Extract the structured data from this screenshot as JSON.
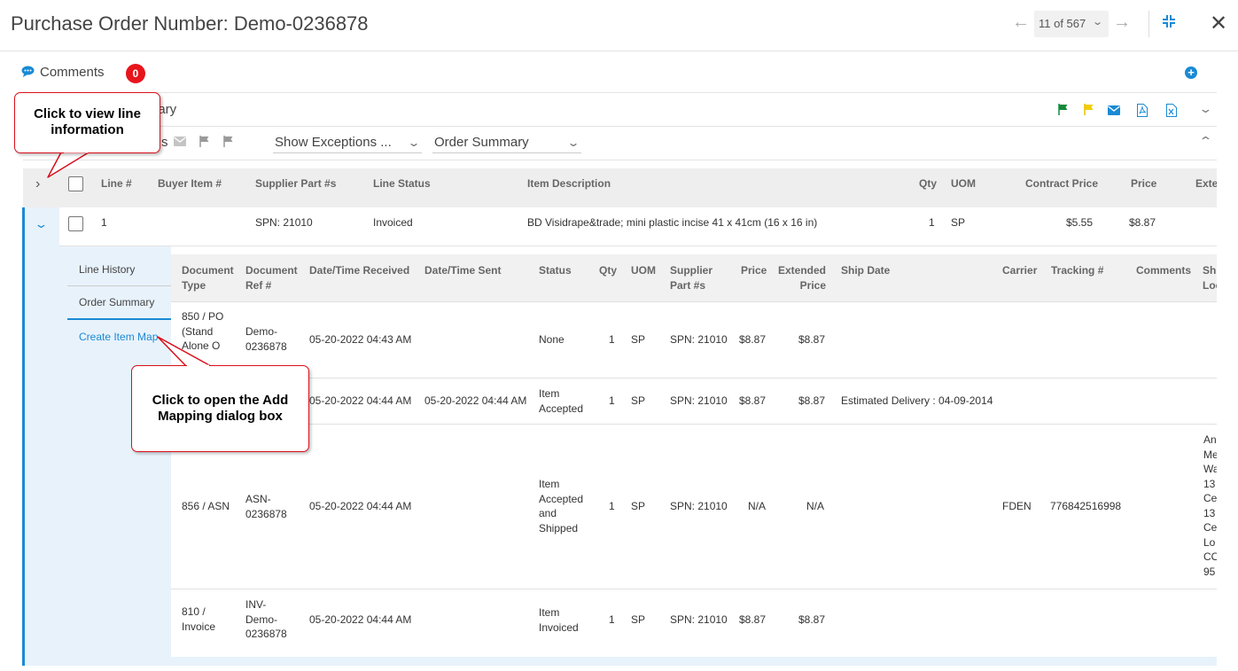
{
  "header": {
    "title": "Purchase Order Number: Demo-0236878",
    "pager_label": "11 of 567"
  },
  "comments": {
    "label": "Comments",
    "count": "0"
  },
  "summary": {
    "label_partial": "nary"
  },
  "toolbar2": {
    "partial_label": "s",
    "exceptions_dropdown": "Show Exceptions ...",
    "view_dropdown": "Order Summary"
  },
  "colors": {
    "accent": "#1a8ad4",
    "badge": "#e8141c",
    "callout_border": "#d8101c"
  },
  "icons": {
    "toolbar": [
      "green-flag-icon",
      "yellow-flag-icon",
      "email-icon",
      "pdf-icon",
      "excel-icon"
    ]
  },
  "grid": {
    "headers": [
      "Line #",
      "Buyer Item #",
      "Supplier Part #s",
      "Line Status",
      "Item Description",
      "Qty",
      "UOM",
      "Contract Price",
      "Price",
      "Exte"
    ],
    "row": {
      "line": "1",
      "supplier_part": "SPN: 21010",
      "status": "Invoiced",
      "description": "BD Visidrape&trade; mini plastic incise 41 x 41cm (16 x 16 in)",
      "qty": "1",
      "uom": "SP",
      "contract_price": "$5.55",
      "price": "$8.87"
    }
  },
  "subnav": {
    "line_history": "Line History",
    "order_summary": "Order Summary",
    "create_item_map": "Create Item Map"
  },
  "sub_table": {
    "headers": {
      "doc_type": "Document Type",
      "doc_ref": "Document Ref #",
      "received": "Date/Time Received",
      "sent": "Date/Time Sent",
      "status": "Status",
      "qty": "Qty",
      "uom": "UOM",
      "supplier_part": "Supplier Part #s",
      "price": "Price",
      "ext_price": "Extended Price",
      "ship_date": "Ship Date",
      "carrier": "Carrier",
      "tracking": "Tracking #",
      "comments": "Comments",
      "ship_loc": "Shi Loc"
    },
    "rows": [
      {
        "doc_type": "850 / PO (Stand Alone O",
        "doc_ref": "Demo-0236878",
        "received": "05-20-2022 04:43 AM",
        "sent": "",
        "status": "None",
        "qty": "1",
        "uom": "SP",
        "supplier_part": "SPN: 21010",
        "price": "$8.87",
        "ext_price": "$8.87",
        "ship_date": "",
        "carrier": "",
        "tracking": ""
      },
      {
        "doc_type": "",
        "doc_ref": "",
        "received": "05-20-2022 04:44 AM",
        "sent": "05-20-2022 04:44 AM",
        "status": "Item Accepted",
        "qty": "1",
        "uom": "SP",
        "supplier_part": "SPN: 21010",
        "price": "$8.87",
        "ext_price": "$8.87",
        "ship_date": "Estimated Delivery : 04-09-2014",
        "carrier": "",
        "tracking": ""
      },
      {
        "doc_type": "856 / ASN",
        "doc_ref": "ASN-0236878",
        "received": "05-20-2022 04:44 AM",
        "sent": "",
        "status": "Item Accepted and Shipped",
        "qty": "1",
        "uom": "SP",
        "supplier_part": "SPN: 21010",
        "price": "N/A",
        "ext_price": "N/A",
        "ship_date": "",
        "carrier": "FDEN",
        "tracking": "776842516998",
        "ship_loc": "An Me Wa 13 Ce 13 Ce Lo CO 95"
      },
      {
        "doc_type": "810 / Invoice",
        "doc_ref": "INV-Demo-0236878",
        "received": "05-20-2022 04:44 AM",
        "sent": "",
        "status": "Item Invoiced",
        "qty": "1",
        "uom": "SP",
        "supplier_part": "SPN: 21010",
        "price": "$8.87",
        "ext_price": "$8.87",
        "ship_date": "",
        "carrier": "",
        "tracking": ""
      }
    ]
  },
  "callouts": {
    "line_info": "Click to view line information",
    "add_mapping": "Click to open the Add Mapping dialog box"
  }
}
